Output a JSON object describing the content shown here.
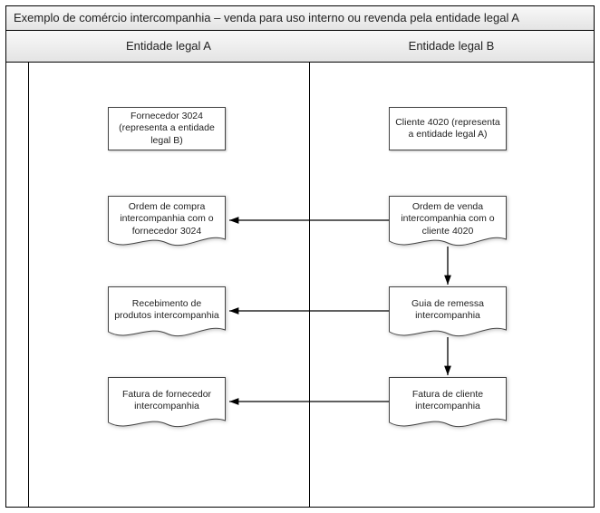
{
  "title": "Exemplo de comércio intercompanhia – venda para uso interno ou revenda pela entidade legal A",
  "lanes": {
    "a": "Entidade legal A",
    "b": "Entidade legal B"
  },
  "nodes": {
    "a_supplier": "Fornecedor 3024 (representa a entidade legal B)",
    "b_customer": "Cliente 4020 (representa a entidade legal A)",
    "a_po": "Ordem de compra intercompanhia com o fornecedor 3024",
    "b_so": "Ordem de venda intercompanhia com o cliente 4020",
    "a_receipt": "Recebimento de produtos intercompanhia",
    "b_packing": "Guia de remessa intercompanhia",
    "a_vinvoice": "Fatura de fornecedor intercompanhia",
    "b_cinvoice": "Fatura de cliente intercompanhia"
  }
}
